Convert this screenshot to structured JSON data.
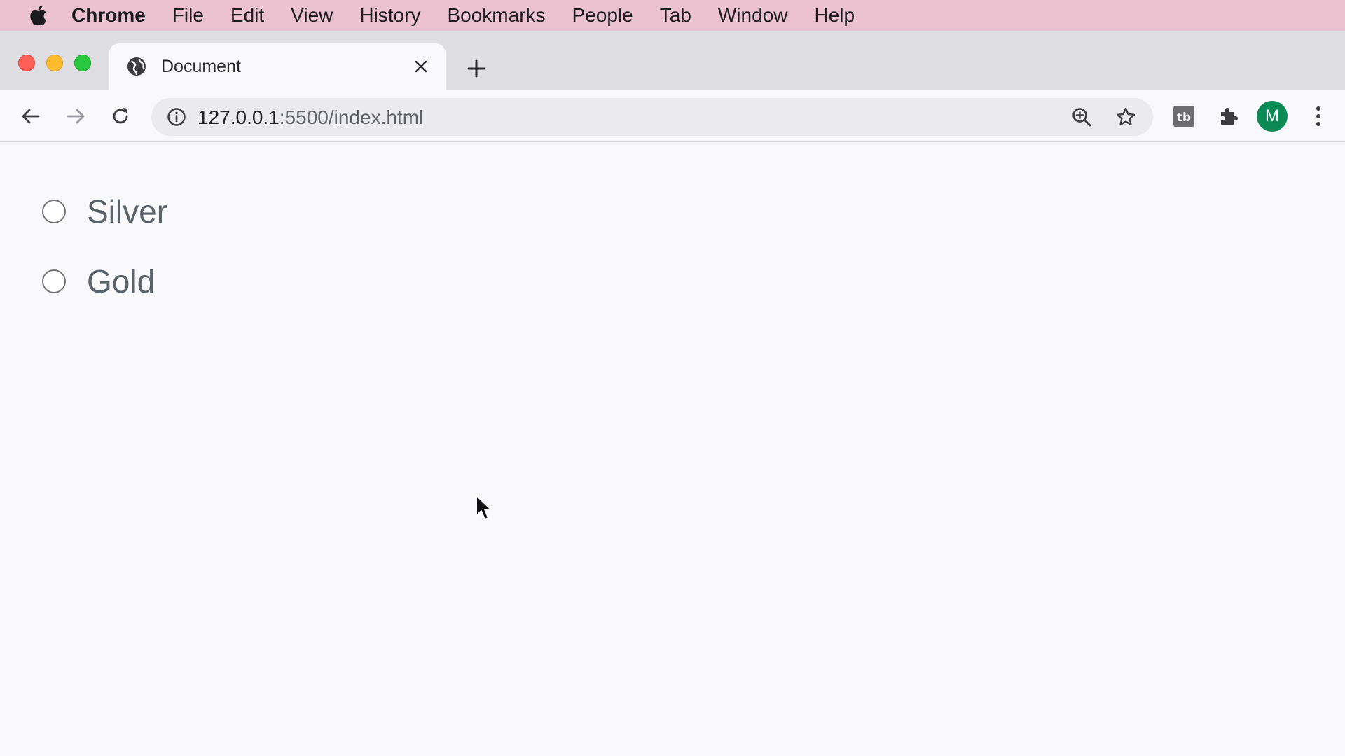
{
  "menubar": {
    "app_name": "Chrome",
    "items": [
      "File",
      "Edit",
      "View",
      "History",
      "Bookmarks",
      "People",
      "Tab",
      "Window",
      "Help"
    ]
  },
  "tab": {
    "title": "Document"
  },
  "address_bar": {
    "host": "127.0.0.1",
    "rest": ":5500/index.html"
  },
  "profile": {
    "initial": "M",
    "color": "#0c8a55"
  },
  "radios": [
    {
      "label": "Silver",
      "checked": false
    },
    {
      "label": "Gold",
      "checked": false
    }
  ],
  "colors": {
    "menubar_bg": "#ecc2d1",
    "tabstrip_bg": "#dedde1",
    "page_bg": "#f9f8fb"
  }
}
